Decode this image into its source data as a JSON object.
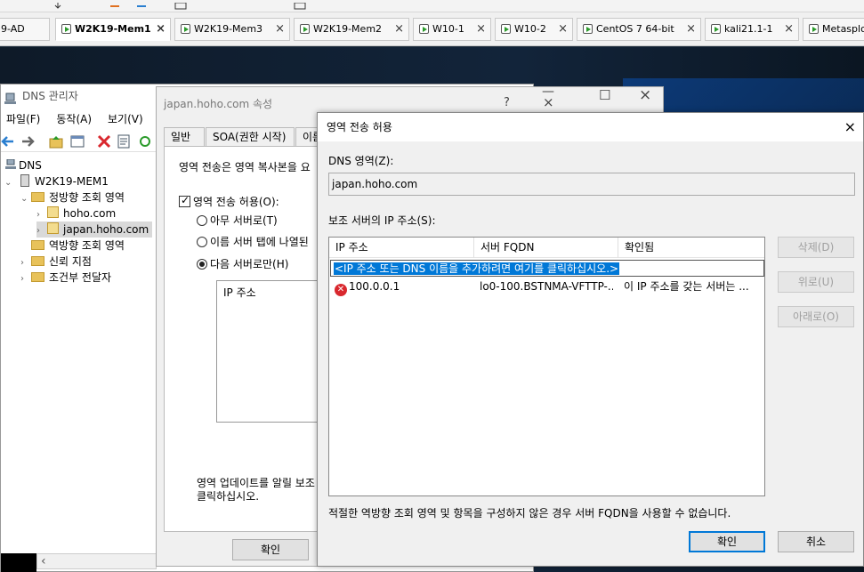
{
  "tabs": [
    {
      "label": "9-AD"
    },
    {
      "label": "W2K19-Mem1"
    },
    {
      "label": "W2K19-Mem3"
    },
    {
      "label": "W2K19-Mem2"
    },
    {
      "label": "W10-1"
    },
    {
      "label": "W10-2"
    },
    {
      "label": "CentOS 7 64-bit"
    },
    {
      "label": "kali21.1-1"
    },
    {
      "label": "Metasploi"
    }
  ],
  "dns_manager": {
    "title": "DNS 관리자",
    "menu": [
      "파일(F)",
      "동작(A)",
      "보기(V)"
    ],
    "tree": [
      {
        "label": "DNS"
      },
      {
        "label": "W2K19-MEM1"
      },
      {
        "label": "정방향 조회 영역"
      },
      {
        "label": "hoho.com"
      },
      {
        "label": "japan.hoho.com"
      },
      {
        "label": "역방향 조회 영역"
      },
      {
        "label": "신뢰 지점"
      },
      {
        "label": "조건부 전달자"
      }
    ]
  },
  "properties": {
    "title": "japan.hoho.com 속성",
    "help": "?",
    "close": "×",
    "tabs": [
      "일반",
      "SOA(권한 시작)",
      "이름"
    ],
    "desc": "영역 전송은 영역 복사본을 요",
    "allow_label": "영역 전송 허용(O):",
    "opt_any": "아무 서버로(T)",
    "opt_ns": "이름 서버 탭에 나열된",
    "opt_only": "다음 서버로만(H)",
    "ip_header": "IP 주소",
    "notify_line1": "영역 업데이트를 알릴 보조",
    "notify_line2": "클릭하십시오.",
    "ok": "확인"
  },
  "zone_transfer": {
    "title": "영역 전송 허용",
    "close": "×",
    "dns_zone_label": "DNS 영역(Z):",
    "dns_zone_value": "japan.hoho.com",
    "secondary_label": "보조 서버의 IP 주소(S):",
    "columns": [
      "IP 주소",
      "서버 FQDN",
      "확인됨"
    ],
    "placeholder": "<IP 주소 또는 DNS 이름을 추가하려면 여기를 클릭하십시오.>",
    "rows": [
      {
        "ip": "100.0.0.1",
        "fqdn": "lo0-100.BSTNMA-VFTTP-...",
        "status": "이 IP 주소를 갖는 서버는 ..."
      }
    ],
    "btn_delete": "삭제(D)",
    "btn_up": "위로(U)",
    "btn_down": "아래로(O)",
    "note": "적절한 역방향 조회 영역 및 항목을 구성하지 않은 경우 서버 FQDN을 사용할 수 없습니다.",
    "ok": "확인",
    "cancel": "취소"
  },
  "colors": {
    "accent": "#0078d7",
    "error": "#d9282e",
    "folder": "#e8c25a"
  }
}
